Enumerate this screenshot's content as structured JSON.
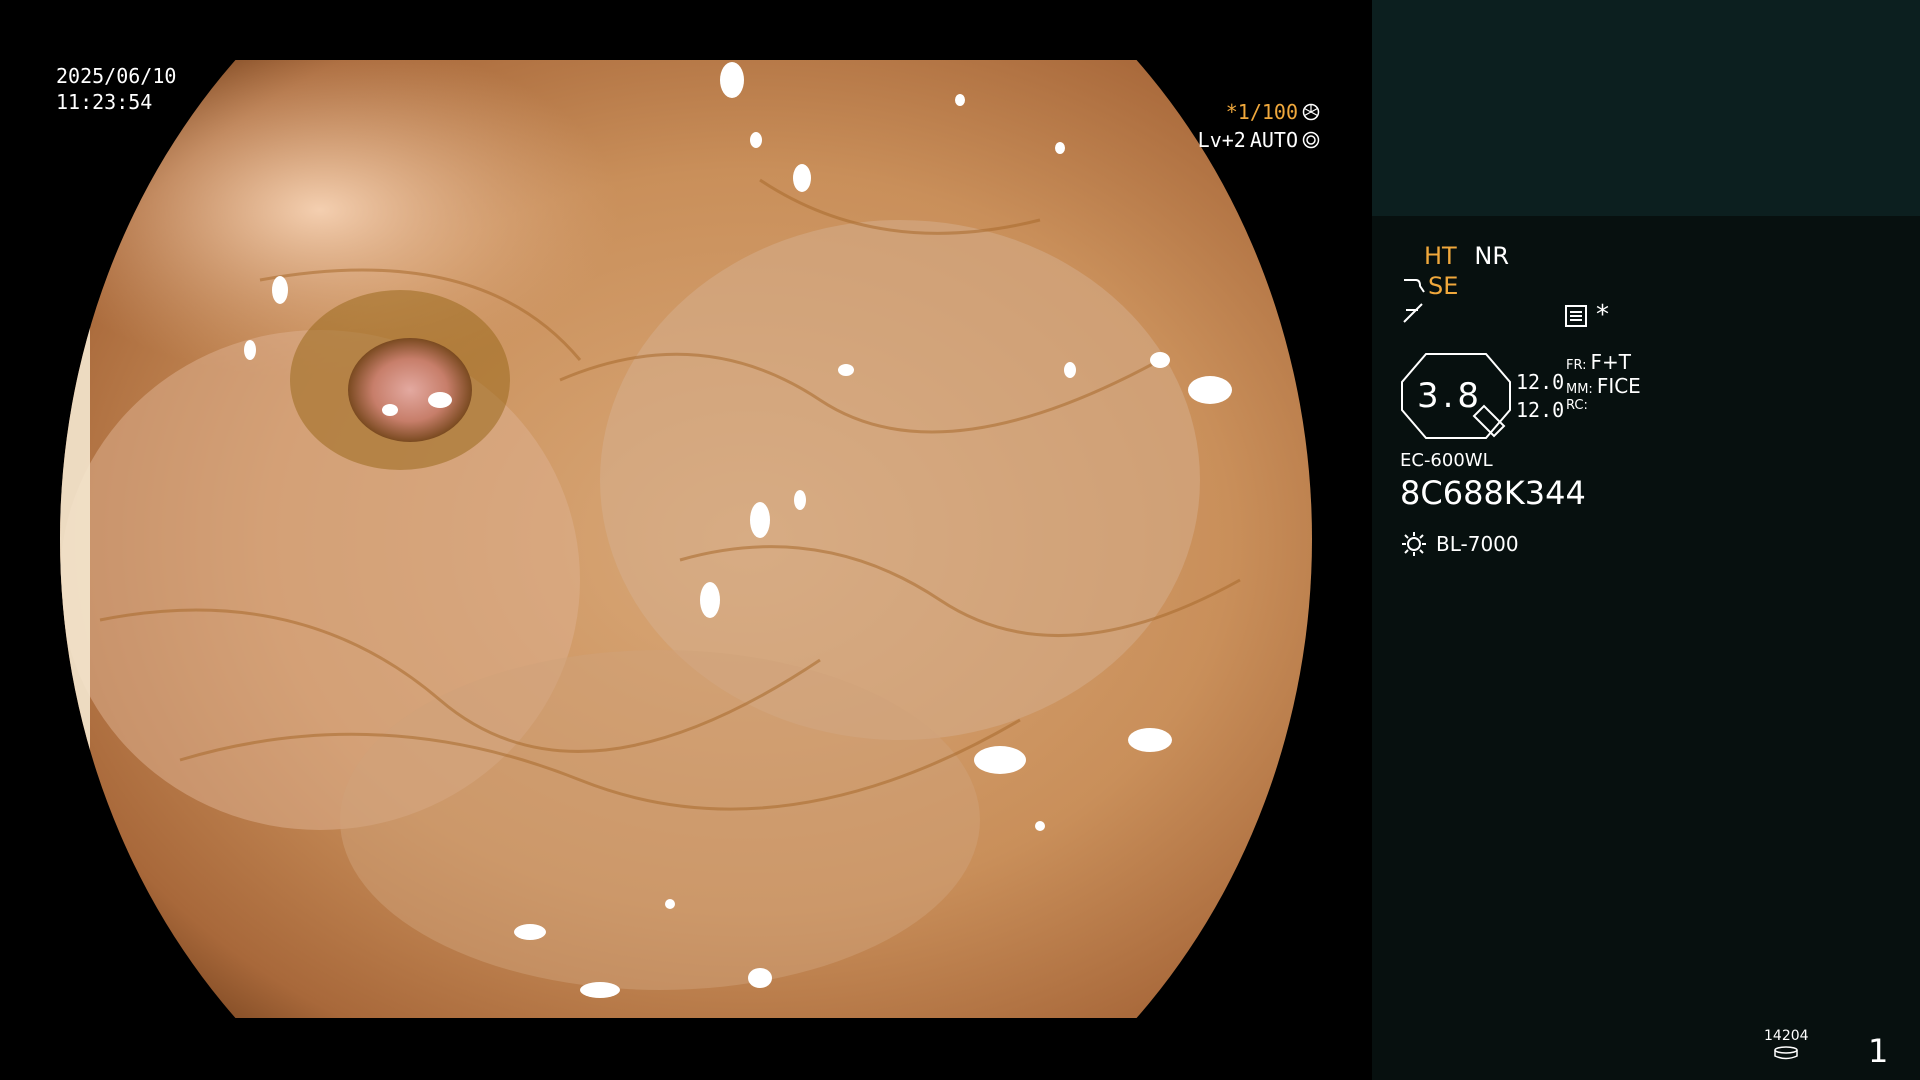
{
  "osd": {
    "date": "2025/06/10",
    "time": "11:23:54",
    "shutter": "*1/100",
    "level": "Lv+2",
    "mode": "AUTO"
  },
  "panel": {
    "ht": "HT",
    "nr": "NR",
    "se": "SE",
    "star": "*",
    "level_value": "3.8",
    "val1": "12.0",
    "val2": "12.0",
    "fr_key": "FR:",
    "fr_val": "F+T",
    "mm_key": "MM:",
    "mm_val": "FICE",
    "rc_key": "RC:",
    "rc_val": "",
    "model": "EC-600WL",
    "serial": "8C688K344",
    "light_source": "BL-7000",
    "count": "14204",
    "page": "1"
  },
  "colors": {
    "accent": "#f0a83c",
    "panel_top": "#0c1f1f",
    "panel_bg": "#07100f"
  },
  "icons": {
    "shutter": "aperture-icon",
    "auto": "iris-icon",
    "se": "endoscope-tip-icon",
    "curve": "curve-icon",
    "monitor": "monitor-settings-icon",
    "light": "sun-icon",
    "disk": "disk-icon"
  }
}
